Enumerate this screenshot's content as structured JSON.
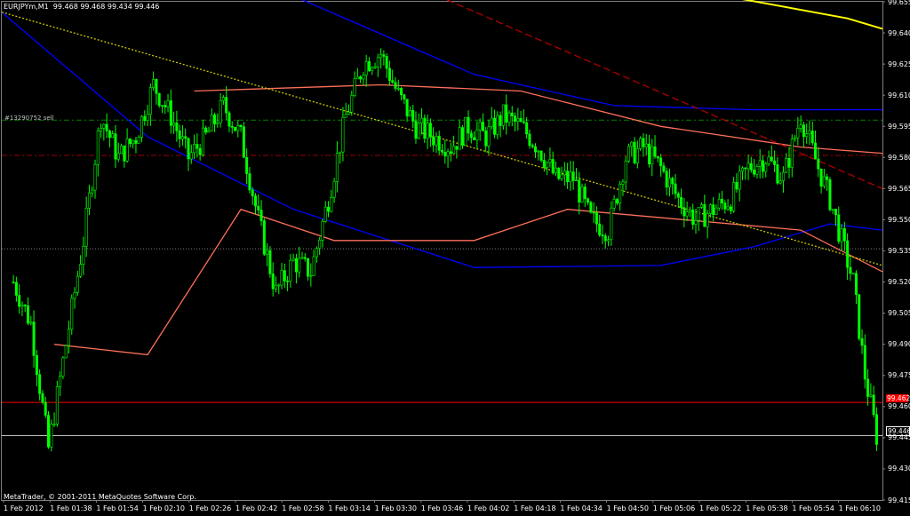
{
  "header": {
    "symbol": "EURJPYm",
    "timeframe": "M1",
    "ohlc": "99.468 99.468 99.434 99.446"
  },
  "order_label": "#13290752 sell",
  "footer": "MetaTrader, © 2001-2011 MetaQuotes Software Corp.",
  "price_axis": [
    "99.655",
    "99.640",
    "99.625",
    "99.610",
    "99.595",
    "99.580",
    "99.565",
    "99.550",
    "99.535",
    "99.520",
    "99.505",
    "99.490",
    "99.475",
    "99.460",
    "99.445",
    "99.430",
    "99.415"
  ],
  "time_axis": [
    "1 Feb 2012",
    "1 Feb 01:38",
    "1 Feb 01:54",
    "1 Feb 02:10",
    "1 Feb 02:26",
    "1 Feb 02:42",
    "1 Feb 02:58",
    "1 Feb 03:14",
    "1 Feb 03:30",
    "1 Feb 03:46",
    "1 Feb 04:02",
    "1 Feb 04:18",
    "1 Feb 04:34",
    "1 Feb 04:50",
    "1 Feb 05:06",
    "1 Feb 05:22",
    "1 Feb 05:38",
    "1 Feb 05:54",
    "1 Feb 06:10"
  ],
  "price_tags": {
    "ask": "99.462",
    "bid": "99.446"
  },
  "colors": {
    "candles": "#00ff00",
    "bands": "#ff6f5a",
    "ma_blue": "#0000ff",
    "ma_yellow": "#ffff00",
    "grid_level_green": "#008000",
    "grid_level_red": "#ff0000",
    "background": "#000000"
  },
  "chart_data": {
    "type": "candlestick",
    "symbol": "EURJPYm",
    "timeframe": "M1",
    "ylim": [
      99.415,
      99.655
    ],
    "levels": {
      "order_line": 99.598,
      "red_dash_level": 99.581,
      "gray_dotted_level": 99.536,
      "ask_line": 99.462,
      "bid_line": 99.446
    },
    "close_path": [
      {
        "t": "01:24",
        "close": 99.52
      },
      {
        "t": "01:30",
        "close": 99.5
      },
      {
        "t": "01:36",
        "close": 99.44
      },
      {
        "t": "01:42",
        "close": 99.49
      },
      {
        "t": "01:48",
        "close": 99.54
      },
      {
        "t": "01:54",
        "close": 99.6
      },
      {
        "t": "02:00",
        "close": 99.58
      },
      {
        "t": "02:06",
        "close": 99.59
      },
      {
        "t": "02:12",
        "close": 99.615
      },
      {
        "t": "02:18",
        "close": 99.6
      },
      {
        "t": "02:24",
        "close": 99.58
      },
      {
        "t": "02:30",
        "close": 99.59
      },
      {
        "t": "02:36",
        "close": 99.605
      },
      {
        "t": "02:42",
        "close": 99.59
      },
      {
        "t": "02:48",
        "close": 99.55
      },
      {
        "t": "02:54",
        "close": 99.515
      },
      {
        "t": "03:00",
        "close": 99.53
      },
      {
        "t": "03:06",
        "close": 99.525
      },
      {
        "t": "03:12",
        "close": 99.56
      },
      {
        "t": "03:18",
        "close": 99.6
      },
      {
        "t": "03:24",
        "close": 99.625
      },
      {
        "t": "03:30",
        "close": 99.63
      },
      {
        "t": "03:36",
        "close": 99.61
      },
      {
        "t": "03:42",
        "close": 99.595
      },
      {
        "t": "03:48",
        "close": 99.59
      },
      {
        "t": "03:54",
        "close": 99.585
      },
      {
        "t": "04:00",
        "close": 99.595
      },
      {
        "t": "04:06",
        "close": 99.59
      },
      {
        "t": "04:12",
        "close": 99.6
      },
      {
        "t": "04:18",
        "close": 99.595
      },
      {
        "t": "04:24",
        "close": 99.585
      },
      {
        "t": "04:30",
        "close": 99.57
      },
      {
        "t": "04:36",
        "close": 99.57
      },
      {
        "t": "04:42",
        "close": 99.55
      },
      {
        "t": "04:48",
        "close": 99.545
      },
      {
        "t": "04:54",
        "close": 99.58
      },
      {
        "t": "05:00",
        "close": 99.585
      },
      {
        "t": "05:06",
        "close": 99.575
      },
      {
        "t": "05:12",
        "close": 99.56
      },
      {
        "t": "05:18",
        "close": 99.55
      },
      {
        "t": "05:24",
        "close": 99.555
      },
      {
        "t": "05:30",
        "close": 99.56
      },
      {
        "t": "05:36",
        "close": 99.575
      },
      {
        "t": "05:42",
        "close": 99.58
      },
      {
        "t": "05:48",
        "close": 99.57
      },
      {
        "t": "05:54",
        "close": 99.6
      },
      {
        "t": "06:00",
        "close": 99.575
      },
      {
        "t": "06:04",
        "close": 99.56
      },
      {
        "t": "06:08",
        "close": 99.54
      },
      {
        "t": "06:12",
        "close": 99.52
      },
      {
        "t": "06:16",
        "close": 99.475
      },
      {
        "t": "06:20",
        "close": 99.446
      }
    ],
    "indicators": [
      {
        "kind": "moving_average",
        "color": "yellow",
        "points": [
          [
            "01:20",
            99.675
          ],
          [
            "04:00",
            99.675
          ],
          [
            "05:00",
            99.665
          ],
          [
            "06:10",
            99.647
          ],
          [
            "06:22",
            99.642
          ]
        ]
      },
      {
        "kind": "moving_average",
        "color": "blue",
        "points": [
          [
            "01:20",
            99.65
          ],
          [
            "02:10",
            99.59
          ],
          [
            "03:00",
            99.555
          ],
          [
            "04:02",
            99.527
          ],
          [
            "05:06",
            99.528
          ],
          [
            "05:38",
            99.537
          ],
          [
            "06:04",
            99.548
          ],
          [
            "06:22",
            99.545
          ]
        ]
      },
      {
        "kind": "moving_average",
        "color": "blue",
        "points": [
          [
            "02:40",
            99.67
          ],
          [
            "04:02",
            99.62
          ],
          [
            "04:50",
            99.605
          ],
          [
            "05:38",
            99.603
          ],
          [
            "06:22",
            99.603
          ]
        ]
      },
      {
        "kind": "bollinger_upper",
        "color": "salmon",
        "points": [
          [
            "02:26",
            99.612
          ],
          [
            "03:30",
            99.615
          ],
          [
            "04:18",
            99.612
          ],
          [
            "05:06",
            99.595
          ],
          [
            "05:54",
            99.585
          ],
          [
            "06:22",
            99.582
          ]
        ]
      },
      {
        "kind": "bollinger_lower",
        "color": "salmon",
        "points": [
          [
            "01:38",
            99.49
          ],
          [
            "02:10",
            99.485
          ],
          [
            "02:42",
            99.555
          ],
          [
            "03:14",
            99.54
          ],
          [
            "04:02",
            99.54
          ],
          [
            "04:34",
            99.555
          ],
          [
            "05:54",
            99.545
          ],
          [
            "06:22",
            99.525
          ]
        ]
      },
      {
        "kind": "trend_line",
        "color": "dark red",
        "points": [
          [
            "03:46",
            99.66
          ],
          [
            "06:22",
            99.565
          ]
        ]
      },
      {
        "kind": "trend_line",
        "color": "yellow dotted",
        "points": [
          [
            "01:20",
            99.65
          ],
          [
            "06:22",
            99.528
          ]
        ]
      }
    ]
  }
}
